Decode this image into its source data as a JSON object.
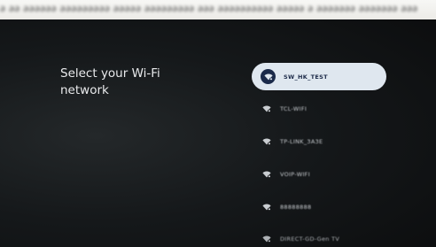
{
  "colors": {
    "background": "#121416",
    "selected_item_bg": "#dfe7ef",
    "selected_text": "#1d2b49",
    "item_text": "#c9cdd1",
    "title_text": "#e9eaec"
  },
  "top_strip": {
    "text": "ǝ ǝǝ ǝǝǝǝǝǝ ǝǝǝǝǝǝǝǝǝ ǝǝǝǝǝ ǝǝǝǝǝǝǝǝǝ ǝǝǝ ǝǝǝǝǝǝǝǝǝǝ ǝǝǝǝǝ ǝ ǝǝǝǝǝǝǝ ǝǝǝǝǝǝǝ ǝǝǝ"
  },
  "page": {
    "title": "Select your Wi-Fi network"
  },
  "networks": [
    {
      "ssid": "SW_HK_TEST",
      "icon": "wifi-lock-icon",
      "selected": true
    },
    {
      "ssid": "TCL-WIFI",
      "icon": "wifi-lock-icon",
      "selected": false
    },
    {
      "ssid": "TP-LINK_3A3E",
      "icon": "wifi-lock-icon",
      "selected": false
    },
    {
      "ssid": "VOIP-WIFI",
      "icon": "wifi-lock-icon",
      "selected": false
    },
    {
      "ssid": "88888888",
      "icon": "wifi-lock-icon",
      "selected": false
    },
    {
      "ssid": "DIRECT-GD-Gen TV",
      "icon": "wifi-lock-icon",
      "selected": false
    }
  ]
}
